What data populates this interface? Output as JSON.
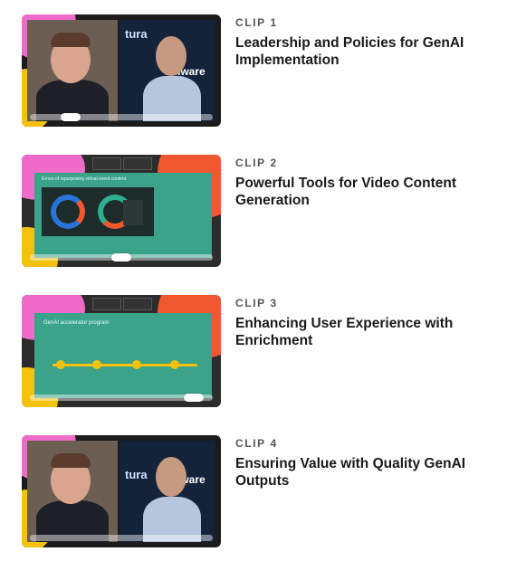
{
  "clips": [
    {
      "number": "CLIP 1",
      "title": "Leadership and Policies for GenAI Implementation",
      "progress": 0.22
    },
    {
      "number": "CLIP 2",
      "title": "Powerful Tools for Video Content Generation",
      "progress": 0.5
    },
    {
      "number": "CLIP 3",
      "title": "Enhancing User Experience with Enrichment",
      "progress": 0.92
    },
    {
      "number": "CLIP 4",
      "title": "Ensuring Value with Quality GenAI Outputs",
      "progress": 0.0
    }
  ],
  "thumbnails": {
    "brand_text": [
      "tura",
      "vmware",
      "vm"
    ],
    "slide_clip2_heading": "Errors of repurposing virtual event content",
    "slide_clip3_heading": "GenAI accelerator program"
  },
  "colors": {
    "pink": "#ef6bc9",
    "orange": "#f2582f",
    "yellow": "#f4c20d",
    "teal": "#2fae8f",
    "blue": "#2a73d9",
    "dark": "#1b1b1b"
  }
}
